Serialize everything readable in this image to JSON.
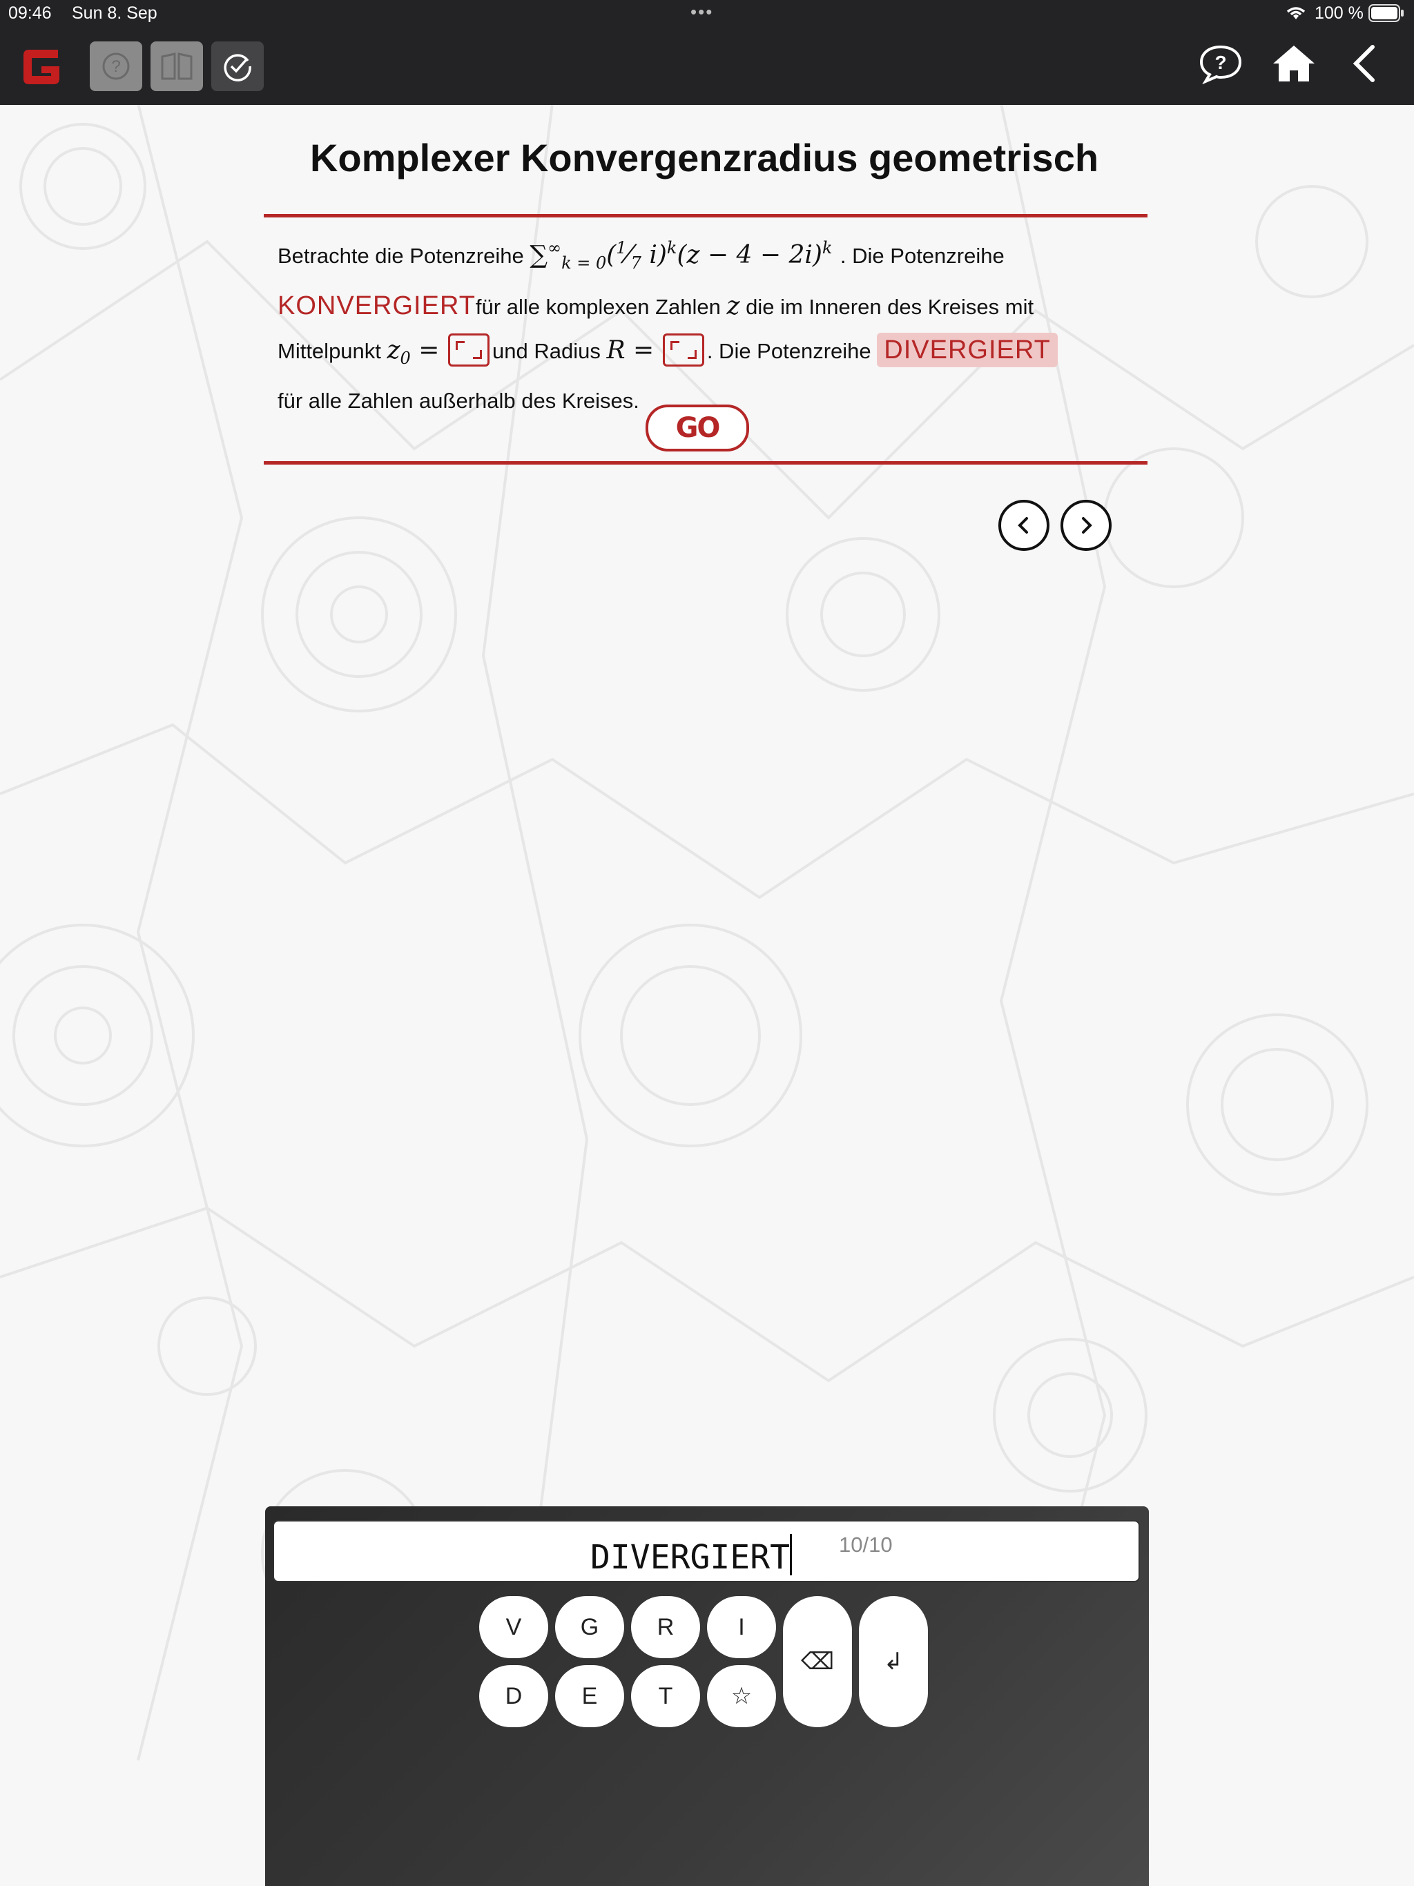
{
  "status_bar": {
    "time": "09:46",
    "date": "Sun 8. Sep",
    "dots": "•••",
    "battery": "100 %"
  },
  "toolbar": {
    "logo_icon": "app-logo-g",
    "buttons": [
      {
        "icon": "help-circle-icon",
        "state": "disabled"
      },
      {
        "icon": "book-icon",
        "state": "disabled"
      },
      {
        "icon": "check-circle-icon",
        "state": "active"
      }
    ],
    "right_icons": [
      "chat-help-icon",
      "home-icon",
      "back-chevron-icon"
    ]
  },
  "page": {
    "title": "Komplexer Konvergenzradius geometrisch",
    "question": {
      "intro": "Betrachte die Potenzreihe",
      "sum_symbol": "∑",
      "sum_upper": "∞",
      "sum_lower": "k = 0",
      "term_coeff": "(",
      "frac_num": "1",
      "frac_den": "7",
      "term_rest": " i)",
      "exp1": "k",
      "term_z": "(z − 4 − 2i)",
      "exp2": "k",
      "after_sum": ". Die Potenzreihe",
      "word_converge": "KONVERGIERT",
      "text2": "für alle komplexen Zahlen",
      "var_z": "z",
      "text3": "die im Inneren des Kreises mit",
      "text4": "Mittelpunkt",
      "center_var": "z",
      "center_sub": "0",
      "eq": " =",
      "text5": "und Radius",
      "radius_var": "R =",
      "text6": ". Die Potenzreihe",
      "word_diverge": "DIVERGIERT",
      "text7": "für alle Zahlen außerhalb des Kreises."
    },
    "go_label": "GO"
  },
  "keyboard": {
    "value": "DIVERGIERT",
    "counter": "10/10",
    "row1": [
      "V",
      "G",
      "R",
      "I"
    ],
    "row2": [
      "D",
      "E",
      "T",
      "☆"
    ],
    "backspace_icon": "backspace-icon",
    "enter_icon": "enter-icon",
    "backspace_glyph": "⌫",
    "enter_glyph": "↲"
  },
  "colors": {
    "accent": "#b52626",
    "bar": "#232326",
    "highlight": "#f0c7c7"
  }
}
